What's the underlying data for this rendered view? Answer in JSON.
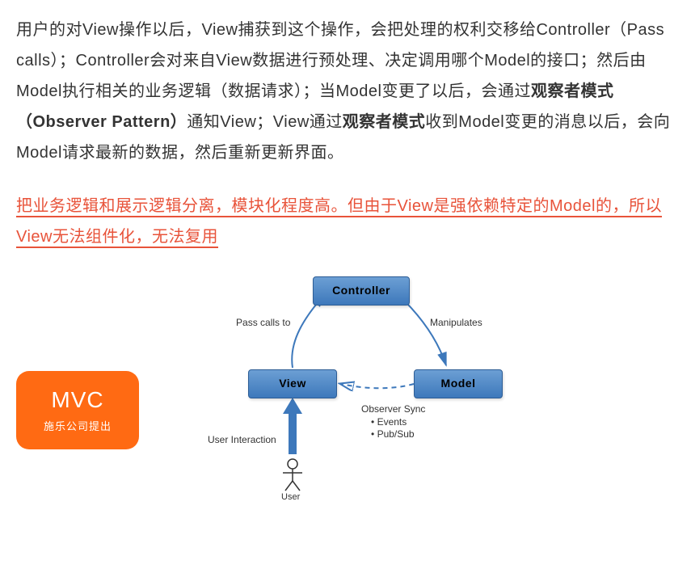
{
  "paragraph": {
    "p1": "用户的对View操作以后，View捕获到这个操作，会把处理的权利交移给Controller（Pass calls）；Controller会对来自View数据进行预处理、决定调用哪个Model的接口；然后由Model执行相关的业务逻辑（数据请求）；当Model变更了以后，会通过",
    "b1": "观察者模式（Observer Pattern）",
    "p2": "通知View；View通过",
    "b2": "观察者模式",
    "p3": "收到Model变更的消息以后，会向Model请求最新的数据，然后重新更新界面。"
  },
  "callout": "把业务逻辑和展示逻辑分离，模块化程度高。但由于View是强依赖特定的Model的，所以View无法组件化，无法复用",
  "badge": {
    "title": "MVC",
    "subtitle": "施乐公司提出"
  },
  "diagram": {
    "controller": "Controller",
    "view": "View",
    "model": "Model",
    "pass_calls": "Pass calls to",
    "manipulates": "Manipulates",
    "user_interaction": "User Interaction",
    "observer_title": "Observer Sync",
    "observer_b1": "Events",
    "observer_b2": "Pub/Sub",
    "user": "User"
  }
}
